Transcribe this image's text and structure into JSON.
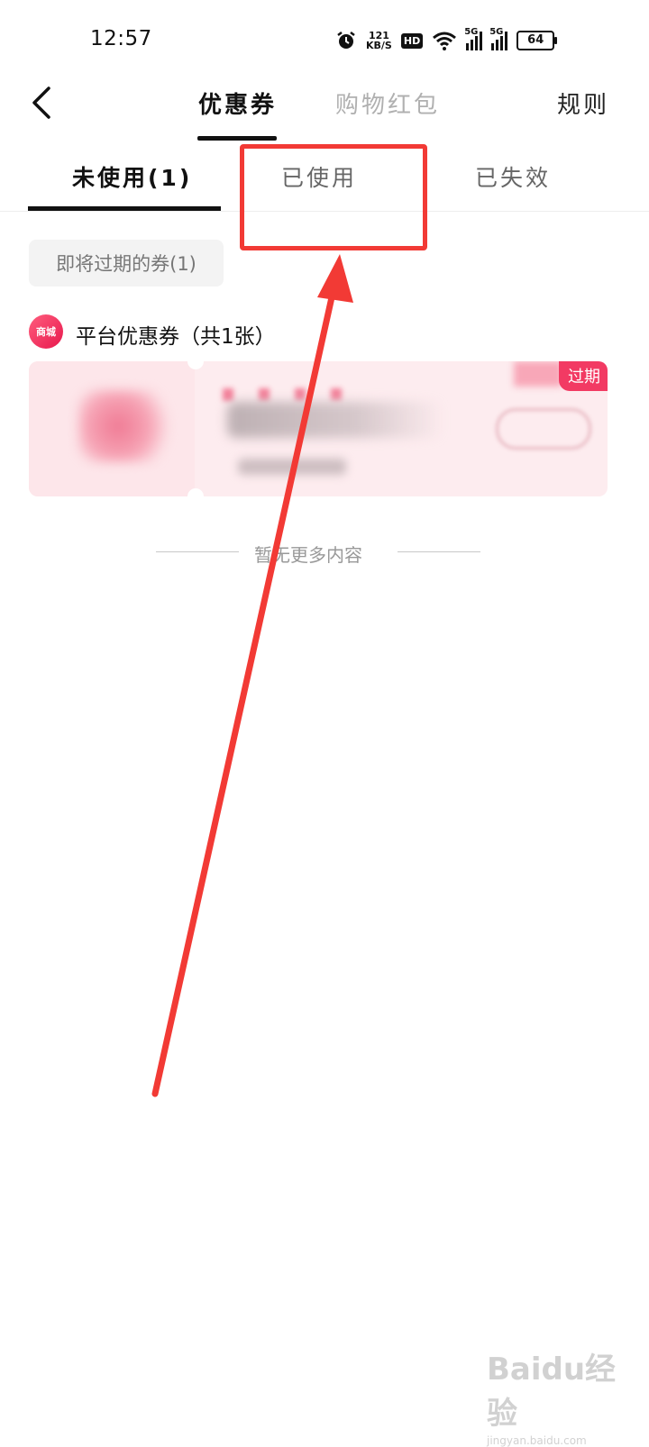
{
  "status_bar": {
    "time": "12:57",
    "net_speed_value": "121",
    "net_speed_unit": "KB/S",
    "hd_label": "HD",
    "sig1_label": "5G",
    "sig2_label": "5G",
    "battery": "64"
  },
  "header": {
    "tabs": [
      {
        "label": "优惠券",
        "active": true
      },
      {
        "label": "购物红包",
        "active": false
      }
    ],
    "rules_label": "规则"
  },
  "sub_tabs": [
    {
      "label": "未使用(1)",
      "active": true
    },
    {
      "label": "已使用",
      "active": false
    },
    {
      "label": "已失效",
      "active": false
    }
  ],
  "filter_chip": "即将过期的券(1)",
  "section": {
    "logo_text": "商城",
    "title": "平台优惠券（共1张）"
  },
  "coupon": {
    "badge": "过期"
  },
  "end_text": "暂无更多内容",
  "watermark": {
    "brand": "Baidu经验",
    "url": "jingyan.baidu.com"
  },
  "colors": {
    "accent": "#f23a63",
    "annotation_red": "#f23a35"
  }
}
